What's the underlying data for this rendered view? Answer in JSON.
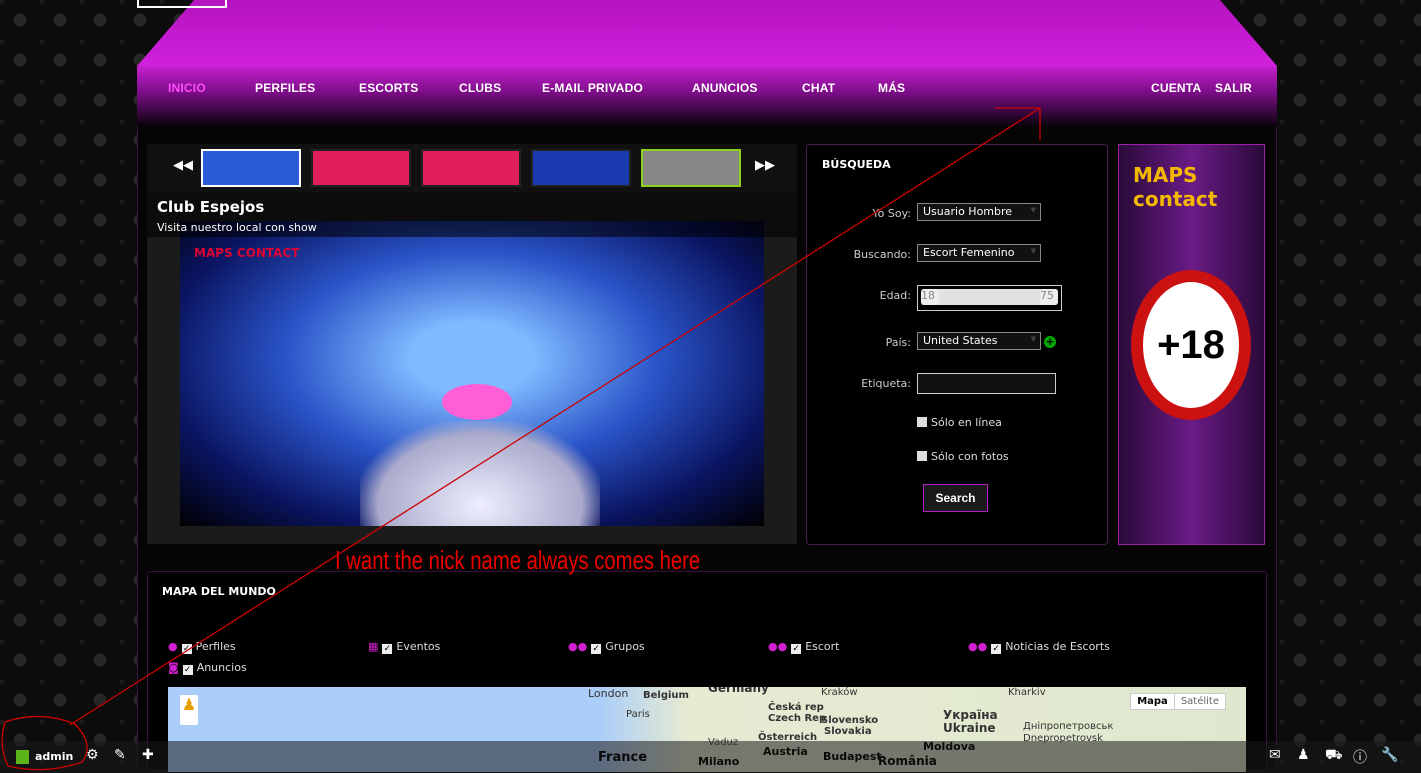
{
  "nav": {
    "items": [
      "INICIO",
      "PERFILES",
      "ESCORTS",
      "CLUBS",
      "E-MAIL PRIVADO",
      "ANUNCIOS",
      "CHAT",
      "MÁS"
    ],
    "right": [
      "CUENTA",
      "SALIR"
    ]
  },
  "slider": {
    "title": "Club Espejos",
    "subtitle": "Visita nuestro local con show",
    "logo_text": "MAPS CONTACT"
  },
  "search": {
    "heading": "BÚSQUEDA",
    "i_am_label": "Yo Soy:",
    "i_am_value": "Usuario Hombre",
    "looking_label": "Buscando:",
    "looking_value": "Escort Femenino",
    "age_label": "Edad:",
    "age_min": "18",
    "age_max": "75",
    "country_label": "País:",
    "country_value": "United States",
    "tag_label": "Etiqueta:",
    "tag_value": "",
    "online_label": "Sólo en línea",
    "photos_label": "Sólo con fotos",
    "button": "Search"
  },
  "ad": {
    "brand": "MAPS contact",
    "badge": "+18"
  },
  "map_section": {
    "heading": "MAPA DEL MUNDO",
    "layers": [
      "Perfiles",
      "Eventos",
      "Grupos",
      "Escort",
      "Noticias de Escorts",
      "Anuncios"
    ],
    "map_type": [
      "Mapa",
      "Satélite"
    ],
    "cities": [
      "London",
      "Belgium",
      "Germany",
      "Kraków",
      "Kharkiv",
      "Paris",
      "Česká rep",
      "Czech Rep",
      "Slovensko",
      "Slovakia",
      "Україна",
      "Ukraine",
      "Дніпропетровськ",
      "Dnepropetrovsk",
      "Vaduz",
      "Österreich",
      "Austria",
      "Budapest",
      "Moldova",
      "France",
      "Milano",
      "România"
    ]
  },
  "annotation": "I want the nick name always comes here",
  "admin_bar": {
    "user": "admin",
    "status_color": "#5bb51a"
  }
}
